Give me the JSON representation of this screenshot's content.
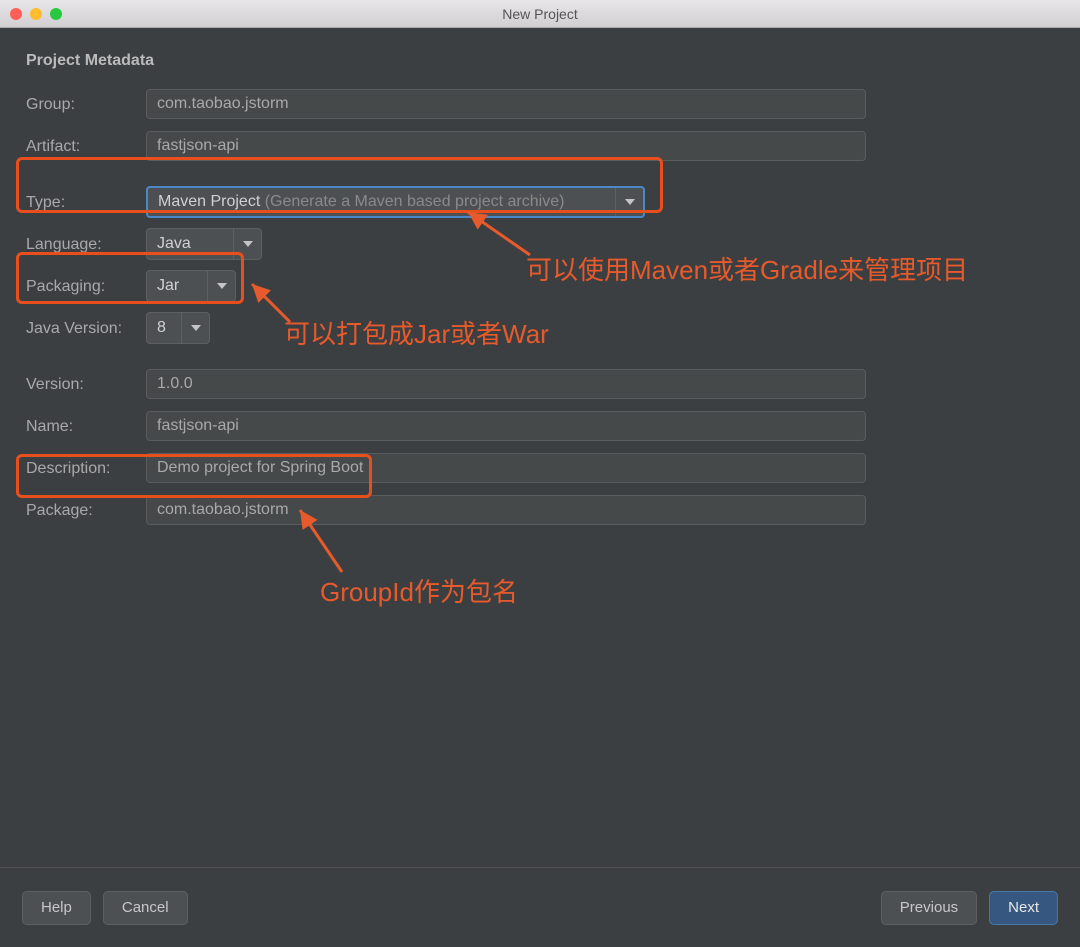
{
  "window": {
    "title": "New Project"
  },
  "section": {
    "title": "Project Metadata"
  },
  "labels": {
    "group": "Group:",
    "artifact": "Artifact:",
    "type": "Type:",
    "language": "Language:",
    "packaging": "Packaging:",
    "javaVersion": "Java Version:",
    "version": "Version:",
    "name": "Name:",
    "description": "Description:",
    "package": "Package:"
  },
  "values": {
    "group": "com.taobao.jstorm",
    "artifact": "fastjson-api",
    "typeMain": "Maven Project",
    "typeHint": " (Generate a Maven based project archive)",
    "language": "Java",
    "packaging": "Jar",
    "javaVersion": "8",
    "version": "1.0.0",
    "name": "fastjson-api",
    "description": "Demo project for Spring Boot",
    "package": "com.taobao.jstorm"
  },
  "annotations": {
    "a1": "可以使用Maven或者Gradle来管理项目",
    "a2": "可以打包成Jar或者War",
    "a3": "GroupId作为包名"
  },
  "buttons": {
    "help": "Help",
    "cancel": "Cancel",
    "previous": "Previous",
    "next": "Next"
  }
}
